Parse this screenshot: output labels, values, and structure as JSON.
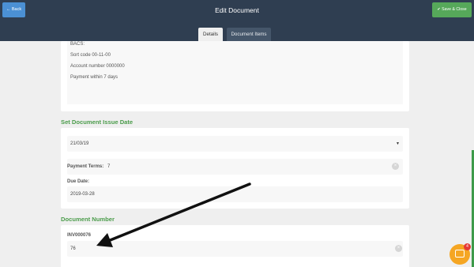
{
  "header": {
    "back_label": "← Back",
    "title": "Edit Document",
    "save_label": "✔ Save & Close"
  },
  "tabs": [
    {
      "label": "Details",
      "active": true
    },
    {
      "label": "Document Items",
      "active": false
    }
  ],
  "payment_info": {
    "lines": [
      "BACS:",
      "Sort code 00-11-00",
      "Account number 0000000",
      "Payment within 7 days"
    ]
  },
  "issue_date": {
    "heading": "Set Document Issue Date",
    "selected": "21/03/19",
    "payment_terms_label": "Payment Terms:",
    "payment_terms_value": "7",
    "due_date_label": "Due Date:",
    "due_date_value": "2019-03-28"
  },
  "document_number": {
    "heading": "Document Number",
    "display": "INV000076",
    "input_value": "76"
  },
  "chat": {
    "badge_count": "4"
  },
  "colors": {
    "header_bg": "#2f3e51",
    "back_button": "#4b90d4",
    "save_button": "#56a85a",
    "section_heading": "#4b9c4b",
    "chat_widget": "#f5a623",
    "badge": "#e53935"
  },
  "icons": {
    "back": "arrow-left-icon",
    "save": "checkmark-icon",
    "dropdown": "caret-down-icon",
    "clear": "close-circle-icon",
    "chat": "chat-icon"
  }
}
